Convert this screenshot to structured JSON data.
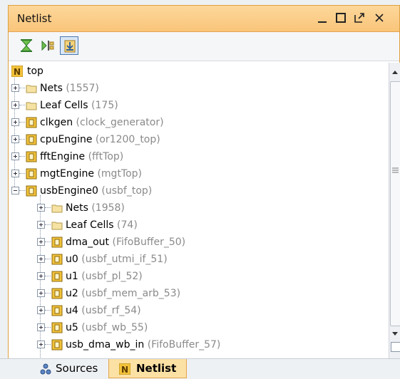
{
  "window": {
    "title": "Netlist"
  },
  "window_controls": [
    "minimize-icon",
    "maximize-icon",
    "float-icon",
    "close-icon"
  ],
  "toolbar": {
    "buttons": [
      "collapse-all-icon",
      "expand-selected-icon",
      "show-hierarchy-icon"
    ]
  },
  "tree": {
    "root": {
      "label": "top"
    },
    "rows": [
      {
        "label": "Nets",
        "sub": "(1557)",
        "kind": "folder",
        "level": 1,
        "expanded": false
      },
      {
        "label": "Leaf Cells",
        "sub": "(175)",
        "kind": "folder",
        "level": 1,
        "expanded": false
      },
      {
        "label": "clkgen",
        "sub": "(clock_generator)",
        "kind": "cell",
        "level": 1,
        "expanded": false
      },
      {
        "label": "cpuEngine",
        "sub": "(or1200_top)",
        "kind": "cell",
        "level": 1,
        "expanded": false
      },
      {
        "label": "fftEngine",
        "sub": "(fftTop)",
        "kind": "cell",
        "level": 1,
        "expanded": false
      },
      {
        "label": "mgtEngine",
        "sub": "(mgtTop)",
        "kind": "cell",
        "level": 1,
        "expanded": false
      },
      {
        "label": "usbEngine0",
        "sub": "(usbf_top)",
        "kind": "cell",
        "level": 1,
        "expanded": true
      },
      {
        "label": "Nets",
        "sub": "(1958)",
        "kind": "folder",
        "level": 2,
        "expanded": false
      },
      {
        "label": "Leaf Cells",
        "sub": "(74)",
        "kind": "folder",
        "level": 2,
        "expanded": false
      },
      {
        "label": "dma_out",
        "sub": "(FifoBuffer_50)",
        "kind": "cell",
        "level": 2,
        "expanded": false
      },
      {
        "label": "u0",
        "sub": "(usbf_utmi_if_51)",
        "kind": "cell",
        "level": 2,
        "expanded": false
      },
      {
        "label": "u1",
        "sub": "(usbf_pl_52)",
        "kind": "cell",
        "level": 2,
        "expanded": false
      },
      {
        "label": "u2",
        "sub": "(usbf_mem_arb_53)",
        "kind": "cell",
        "level": 2,
        "expanded": false
      },
      {
        "label": "u4",
        "sub": "(usbf_rf_54)",
        "kind": "cell",
        "level": 2,
        "expanded": false
      },
      {
        "label": "u5",
        "sub": "(usbf_wb_55)",
        "kind": "cell",
        "level": 2,
        "expanded": false
      },
      {
        "label": "usb_dma_wb_in",
        "sub": "(FifoBuffer_57)",
        "kind": "cell",
        "level": 2,
        "expanded": false
      }
    ]
  },
  "tabs": [
    {
      "label": "Sources",
      "icon": "sources-icon",
      "active": false
    },
    {
      "label": "Netlist",
      "icon": "netlist-icon",
      "active": true
    }
  ],
  "colors": {
    "title_bar": "#f9c57a",
    "active_tab": "#fce1a4",
    "sub_text": "#8a8a8a"
  }
}
